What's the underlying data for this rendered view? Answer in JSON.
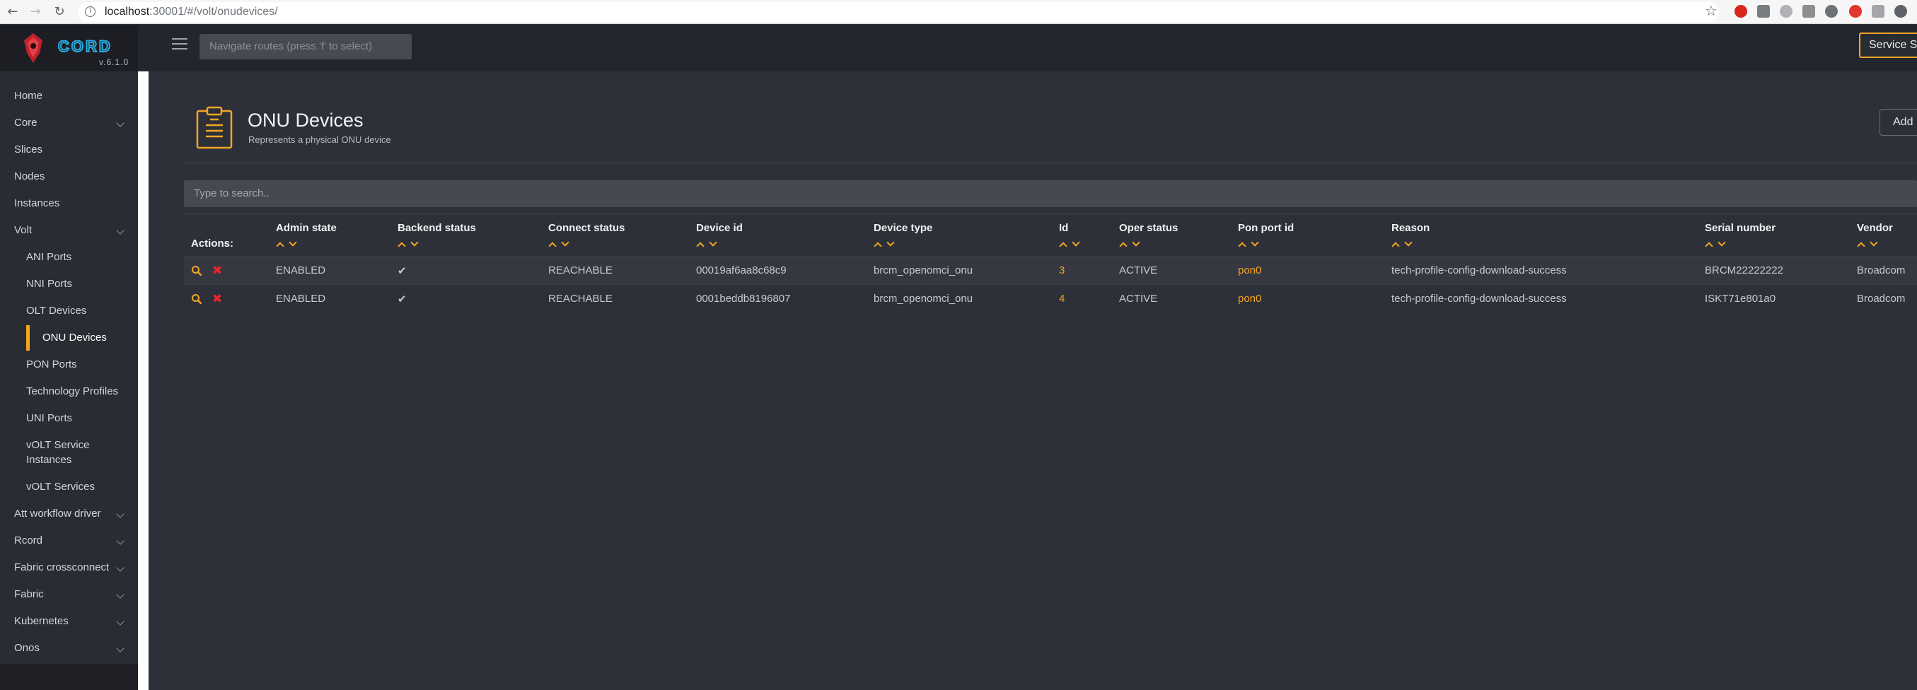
{
  "browser": {
    "url_host": "localhost",
    "url_path": ":30001/#/volt/onudevices/"
  },
  "app": {
    "logo_text": "CORD",
    "version": "v.6.1.0",
    "route_search_placeholder": "Navigate routes (press 'f' to select)",
    "service_button": "Service St"
  },
  "sidebar": {
    "items": [
      {
        "label": "Home",
        "chevron": false
      },
      {
        "label": "Core",
        "chevron": true
      },
      {
        "label": "Slices",
        "chevron": false
      },
      {
        "label": "Nodes",
        "chevron": false
      },
      {
        "label": "Instances",
        "chevron": false
      },
      {
        "label": "Volt",
        "chevron": true
      },
      {
        "label": "ANI Ports",
        "sub": true
      },
      {
        "label": "NNI Ports",
        "sub": true
      },
      {
        "label": "OLT Devices",
        "sub": true
      },
      {
        "label": "ONU Devices",
        "sub": true,
        "active": true
      },
      {
        "label": "PON Ports",
        "sub": true
      },
      {
        "label": "Technology Profiles",
        "sub": true
      },
      {
        "label": "UNI Ports",
        "sub": true
      },
      {
        "label": "vOLT Service",
        "sub": true
      },
      {
        "label": "Instances",
        "sub": true
      },
      {
        "label": "vOLT Services",
        "sub": true
      },
      {
        "label": "Att workflow driver",
        "chevron": true
      },
      {
        "label": "Rcord",
        "chevron": true
      },
      {
        "label": "Fabric crossconnect",
        "chevron": true
      },
      {
        "label": "Fabric",
        "chevron": true
      },
      {
        "label": "Kubernetes",
        "chevron": true
      },
      {
        "label": "Onos",
        "chevron": true
      }
    ]
  },
  "page": {
    "title": "ONU Devices",
    "subtitle": "Represents a physical ONU device",
    "add_button": "Add",
    "search_placeholder": "Type to search.."
  },
  "table": {
    "actions_label": "Actions:",
    "columns": [
      "Admin state",
      "Backend status",
      "Connect status",
      "Device id",
      "Device type",
      "Id",
      "Oper status",
      "Pon port id",
      "Reason",
      "Serial number",
      "Vendor"
    ],
    "rows": [
      {
        "admin_state": "ENABLED",
        "backend_status": "✔",
        "connect_status": "REACHABLE",
        "device_id": "00019af6aa8c68c9",
        "device_type": "brcm_openomci_onu",
        "id": "3",
        "oper_status": "ACTIVE",
        "pon_port_id": "pon0",
        "reason": "tech-profile-config-download-success",
        "serial_number": "BRCM22222222",
        "vendor": "Broadcom"
      },
      {
        "admin_state": "ENABLED",
        "backend_status": "✔",
        "connect_status": "REACHABLE",
        "device_id": "0001beddb8196807",
        "device_type": "brcm_openomci_onu",
        "id": "4",
        "oper_status": "ACTIVE",
        "pon_port_id": "pon0",
        "reason": "tech-profile-config-download-success",
        "serial_number": "ISKT71e801a0",
        "vendor": "Broadcom"
      }
    ]
  },
  "colors": {
    "accent": "#f3a622",
    "delete": "#e8262a",
    "background": "#2d3039",
    "sidebar": "#2a2c33"
  }
}
